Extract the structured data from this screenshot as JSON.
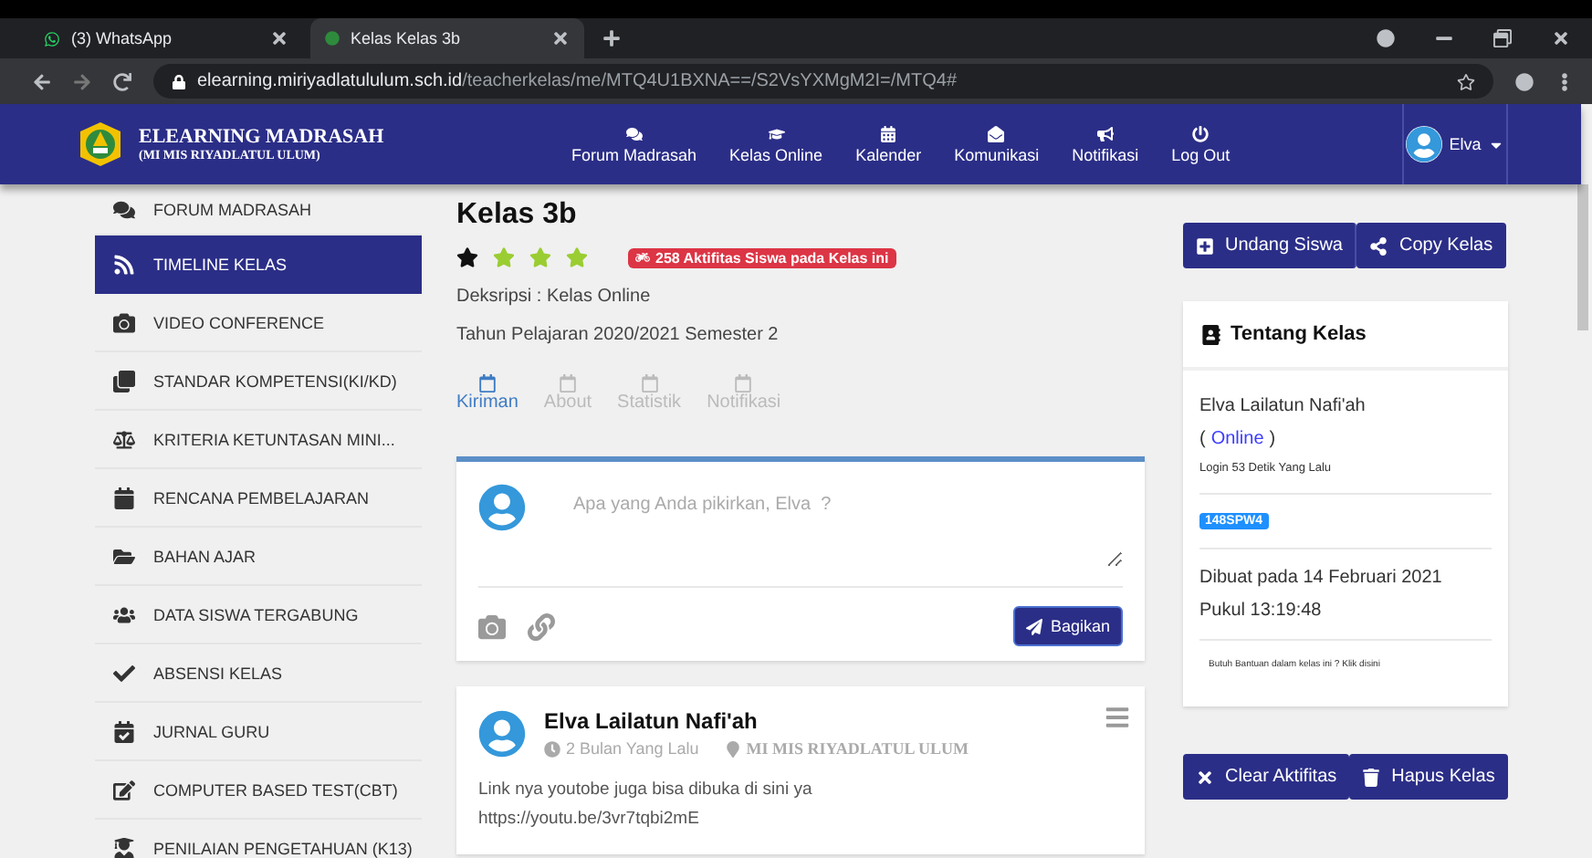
{
  "browser": {
    "tabs": [
      {
        "title": "(3) WhatsApp",
        "selected": false
      },
      {
        "title": "Kelas Kelas 3b",
        "selected": true
      }
    ],
    "url_host": "elearning.miriyadlatululum.sch.id",
    "url_path": "/teacherkelas/me/MTQ4U1BXNA==/S2VsYXMgM2I=/MTQ4#"
  },
  "header": {
    "title": "ELEARNING MADRASAH",
    "subtitle": "(MI MIS RIYADLATUL ULUM)",
    "nav": [
      "Forum Madrasah",
      "Kelas Online",
      "Kalender",
      "Komunikasi",
      "Notifikasi",
      "Log Out"
    ],
    "user": "Elva"
  },
  "sidebar": {
    "items": [
      {
        "label": "FORUM MADRASAH",
        "selected": false
      },
      {
        "label": "TIMELINE KELAS",
        "selected": true
      },
      {
        "label": "VIDEO CONFERENCE",
        "selected": false
      },
      {
        "label": "STANDAR KOMPETENSI(KI/KD)",
        "selected": false
      },
      {
        "label": "KRITERIA KETUNTASAN MINI...",
        "selected": false
      },
      {
        "label": "RENCANA PEMBELAJARAN",
        "selected": false
      },
      {
        "label": "BAHAN AJAR",
        "selected": false
      },
      {
        "label": "DATA SISWA TERGABUNG",
        "selected": false
      },
      {
        "label": "ABSENSI KELAS",
        "selected": false
      },
      {
        "label": "JURNAL GURU",
        "selected": false
      },
      {
        "label": "COMPUTER BASED TEST(CBT)",
        "selected": false
      },
      {
        "label": "PENILAIAN PENGETAHUAN (K13)",
        "selected": false
      }
    ]
  },
  "class": {
    "title": "Kelas 3b",
    "stars": 3,
    "activity_badge": "258 Aktifitas Siswa pada Kelas ini",
    "description": "Deksripsi : Kelas Online",
    "year": "Tahun Pelajaran 2020/2021 Semester 2",
    "tabs": [
      {
        "label": "Kiriman",
        "selected": true
      },
      {
        "label": "About",
        "selected": false
      },
      {
        "label": "Statistik",
        "selected": false
      },
      {
        "label": "Notifikasi",
        "selected": false
      }
    ]
  },
  "composer": {
    "placeholder": "Apa yang Anda pikirkan, Elva  ?",
    "button": "Bagikan"
  },
  "posts": [
    {
      "author": "Elva Lailatun Nafi'ah",
      "time": "2 Bulan Yang Lalu",
      "location": "MI MIS RIYADLATUL ULUM",
      "lines": [
        "Link nya youtobe juga bisa dibuka di sini ya",
        "https://youtu.be/3vr7tqbi2mE"
      ]
    }
  ],
  "actions": [
    "Undang Siswa",
    "Copy Kelas"
  ],
  "about": {
    "title": "Tentang Kelas",
    "teacher": "Elva Lailatun Nafi'ah",
    "status": {
      "open": "(",
      "label": "Online",
      "close": ")"
    },
    "login": "Login 53 Detik Yang Lalu",
    "code": "148SPW4",
    "created": "Dibuat pada 14 Februari 2021",
    "time": "Pukul 13:19:48",
    "help": "Butuh Bantuan dalam kelas ini ? Klik disini"
  },
  "bottom_actions": [
    "Clear Aktifitas",
    "Hapus Kelas"
  ]
}
